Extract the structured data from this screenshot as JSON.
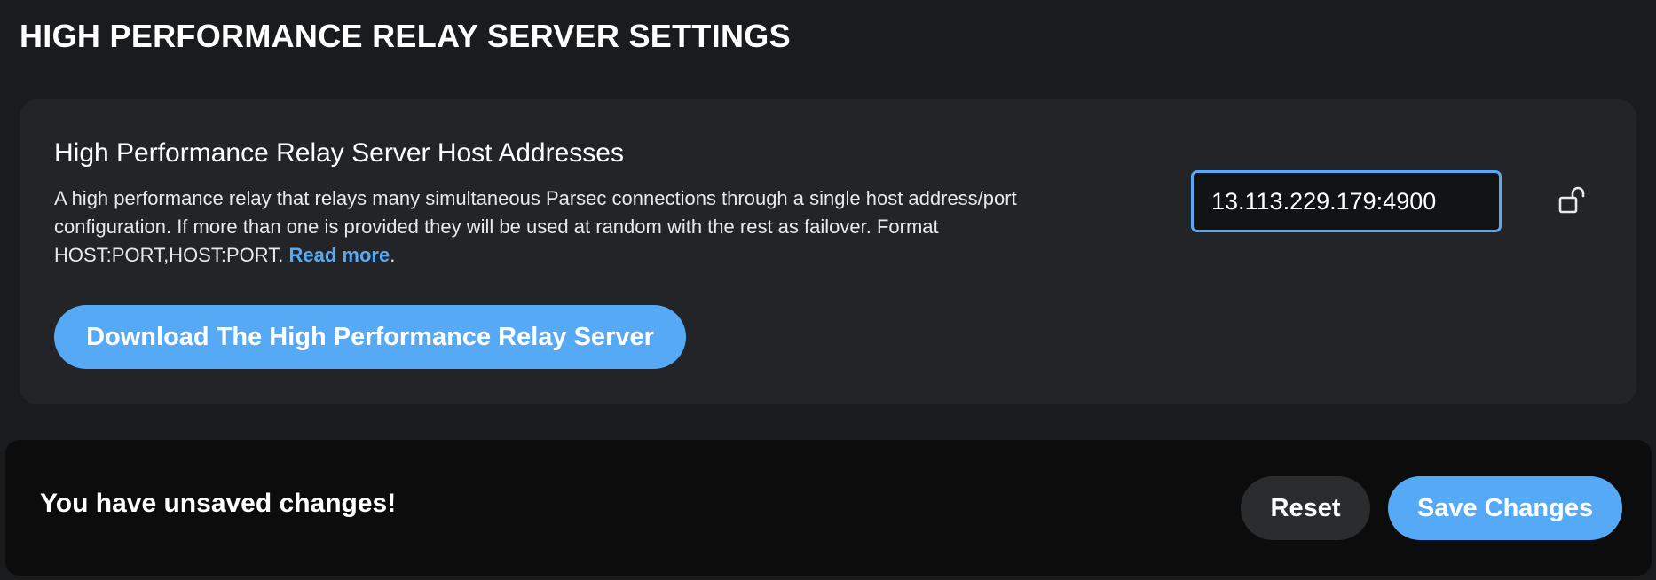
{
  "header": {
    "title": "HIGH PERFORMANCE RELAY SERVER SETTINGS"
  },
  "setting": {
    "title": "High Performance Relay Server Host Addresses",
    "description": "A high performance relay that relays many simultaneous Parsec connections through a single host address/port configuration. If more than one is provided they will be used at random with the rest as failover. Format HOST:PORT,HOST:PORT. ",
    "read_more_label": "Read more",
    "description_end": ".",
    "host_value": "13.113.229.179:4900",
    "lock_icon": "unlocked-padlock-icon",
    "download_label": "Download The High Performance Relay Server"
  },
  "unsaved_bar": {
    "message": "You have unsaved changes!",
    "reset_label": "Reset",
    "save_label": "Save Changes"
  },
  "colors": {
    "background": "#1a1b1d",
    "card": "#232427",
    "accent": "#56aaf5",
    "bar": "#0c0c0d",
    "secondary_button": "#2b2c2e"
  }
}
